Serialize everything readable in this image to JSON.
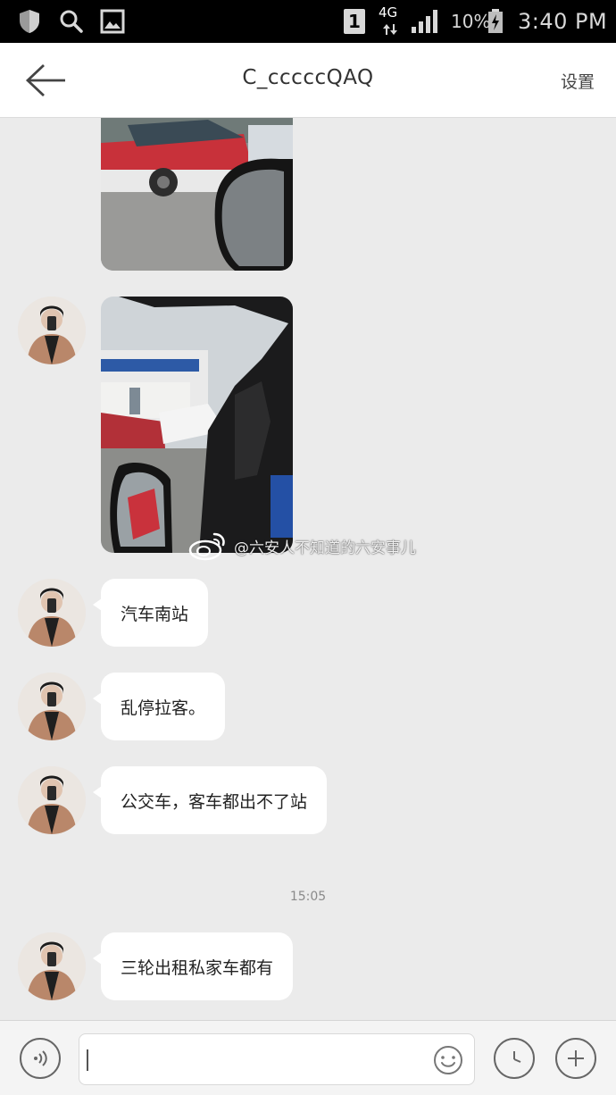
{
  "status_bar": {
    "sim_slot": "1",
    "network_type": "4G",
    "battery_percent": "10%",
    "time": "3:40 PM",
    "icons": [
      "shield-icon",
      "search-icon",
      "image-icon",
      "signal-icon",
      "battery-icon"
    ]
  },
  "header": {
    "title": "C_cccccQAQ",
    "settings_label": "设置",
    "back_icon": "arrow-left-icon"
  },
  "messages": [
    {
      "type": "image",
      "description_icon": "photo-taxi-mirror"
    },
    {
      "type": "image",
      "description_icon": "photo-car-window"
    },
    {
      "type": "text",
      "text": "汽车南站"
    },
    {
      "type": "text",
      "text": "乱停拉客。"
    },
    {
      "type": "text",
      "text": "公交车，客车都出不了站"
    },
    {
      "type": "time",
      "text": "15:05"
    },
    {
      "type": "text",
      "text": "三轮出租私家车都有"
    }
  ],
  "watermark": {
    "text": "@六安人不知道的六安事儿",
    "icon": "weibo-icon"
  },
  "input_bar": {
    "value": "",
    "icons": [
      "voice-icon",
      "emoji-icon",
      "clock-icon",
      "plus-icon"
    ]
  },
  "colors": {
    "chat_background": "#ebebeb",
    "bubble": "#ffffff",
    "status_bar": "#000000",
    "header": "#ffffff"
  }
}
